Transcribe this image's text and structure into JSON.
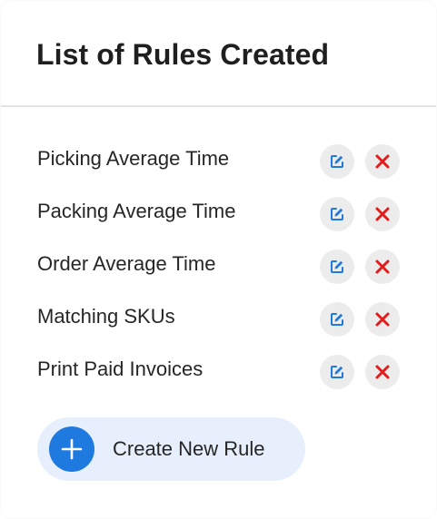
{
  "panel": {
    "title": "List of Rules Created"
  },
  "rules": [
    {
      "label": "Picking Average Time"
    },
    {
      "label": "Packing Average Time"
    },
    {
      "label": "Order Average Time"
    },
    {
      "label": "Matching SKUs"
    },
    {
      "label": "Print Paid Invoices"
    }
  ],
  "actions": {
    "create_label": "Create New Rule"
  },
  "icons": {
    "edit": "edit-icon",
    "delete": "close-icon",
    "create": "plus-icon"
  },
  "colors": {
    "accent": "#1f7ae0",
    "delete": "#e41b1b",
    "create_background": "#e6effb",
    "icon_button_background": "#ececec"
  }
}
